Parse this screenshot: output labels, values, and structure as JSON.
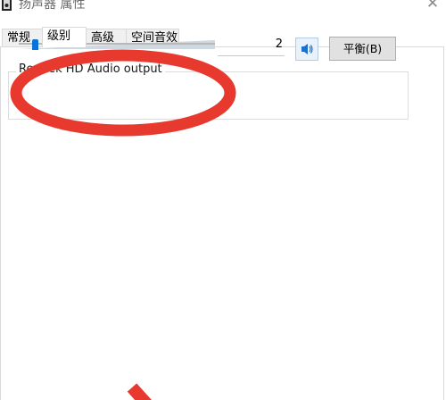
{
  "window": {
    "title": "扬声器 属性",
    "close_symbol": "✕"
  },
  "tabs": [
    {
      "label": "常规",
      "active": false
    },
    {
      "label": "级别",
      "active": true
    },
    {
      "label": "高级",
      "active": false
    },
    {
      "label": "空间音效",
      "active": false
    }
  ],
  "levels": {
    "device_label": "Realtek HD Audio output",
    "volume_value": "2",
    "balance_label": "平衡(B)"
  },
  "colors": {
    "annotation_red": "#e8392f",
    "slider_thumb": "#0a73d9"
  }
}
